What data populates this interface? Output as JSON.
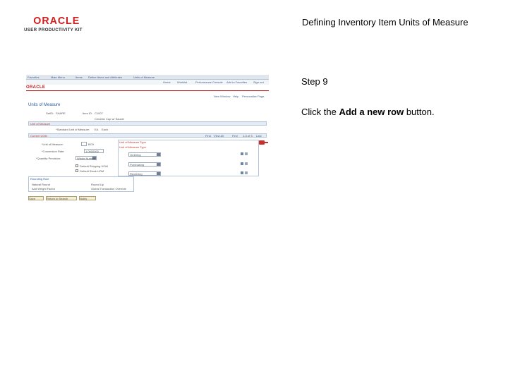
{
  "logo": {
    "brand": "ORACLE",
    "product": "USER PRODUCTIVITY KIT"
  },
  "slide": {
    "title": "Defining Inventory Item Units of Measure",
    "step": "Step 9",
    "instruction_prefix": "Click the ",
    "instruction_bold": "Add a new row",
    "instruction_suffix": " button."
  },
  "screenshot": {
    "topnav": [
      "Favorites",
      "Main Menu",
      "Items",
      "Define Items and Attributes",
      "Units of Measure"
    ],
    "menubar": [
      "Home",
      "Worklist",
      "Performance Console",
      "Add to Favorites",
      "Sign out"
    ],
    "brand": "ORACLE",
    "links": [
      "New Window",
      "Help",
      "Personalize Page"
    ],
    "page_title": "Units of Measure",
    "fields": {
      "setid_label": "SetID:",
      "setid_value": "SHARE",
      "item_label": "Item ID:",
      "item_value": "C1007",
      "desc_value": "Ceramic Cup w/ Saucer",
      "uom_label": "*Standard Unit of Measure:",
      "uom_value": "EA",
      "uom_desc": "Each"
    },
    "section_bar": "Unit of Measure",
    "sub_bar": "Current UOM",
    "left_labels": [
      "*Unit of Measure:",
      "*Conversion Rate:",
      "*Quantity Precision:"
    ],
    "left_values": [
      "BOX",
      "1.0000000",
      "Whole Number"
    ],
    "checkboxes": [
      "Default Shipping UOM",
      "Default Stock UOM"
    ],
    "uom_type_header": "Unit of Measure Type",
    "uom_type_rows": [
      "Ordering",
      "Purchasing",
      "Receiving"
    ],
    "grid_nav": [
      "Find",
      "View All",
      "First",
      "1-3 of 3",
      "Last"
    ],
    "rounding": {
      "title": "Rounding Rule",
      "opt1": "Natural Round",
      "opt2": "Round Up",
      "opt1_sub": "Add Weight Factor",
      "opt2_sub": "Global Transaction Override"
    },
    "buttons": [
      "Save",
      "Return to Search",
      "Notify"
    ]
  }
}
